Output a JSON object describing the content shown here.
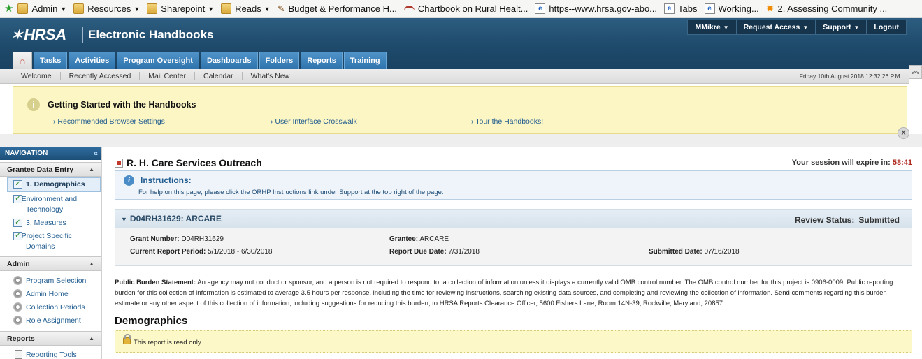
{
  "bookmarks": {
    "items": [
      {
        "label": "Admin",
        "icon": "folder-icon",
        "has_menu": true
      },
      {
        "label": "Resources",
        "icon": "folder-icon",
        "has_menu": true
      },
      {
        "label": "Sharepoint",
        "icon": "folder-icon",
        "has_menu": true
      },
      {
        "label": "Reads",
        "icon": "folder-icon",
        "has_menu": true
      },
      {
        "label": "Budget & Performance  H...",
        "icon": "pen-icon"
      },
      {
        "label": "Chartbook on Rural Healt...",
        "icon": "arc-icon"
      },
      {
        "label": "https--www.hrsa.gov-abo...",
        "icon": "ie-icon"
      },
      {
        "label": "Tabs",
        "icon": "ie-icon"
      },
      {
        "label": "Working...",
        "icon": "ie-icon"
      },
      {
        "label": "2. Assessing Community ...",
        "icon": "sun-icon"
      }
    ]
  },
  "header": {
    "logo": "HRSA",
    "app_title": "Electronic Handbooks",
    "top_links": [
      {
        "label": "MMikre",
        "menu": true
      },
      {
        "label": "Request Access",
        "menu": true
      },
      {
        "label": "Support",
        "menu": true
      },
      {
        "label": "Logout",
        "menu": false
      }
    ],
    "tabs": [
      "Tasks",
      "Activities",
      "Program Oversight",
      "Dashboards",
      "Folders",
      "Reports",
      "Training"
    ]
  },
  "subnav": {
    "items": [
      "Welcome",
      "Recently Accessed",
      "Mail Center",
      "Calendar",
      "What's New"
    ],
    "date": "Friday  10th  August  2018  12:32:26  P.M."
  },
  "getting_started": {
    "title": "Getting Started with the Handbooks",
    "links": [
      "Recommended Browser Settings",
      "User Interface Crosswalk",
      "Tour the Handbooks!"
    ]
  },
  "nav": {
    "header": "NAVIGATION",
    "sections": [
      {
        "title": "Grantee Data Entry",
        "items": [
          "1. Demographics",
          "2. Environment and Technology",
          "3. Measures",
          "4. Project Specific Domains"
        ]
      },
      {
        "title": "Admin",
        "items": [
          "Program Selection",
          "Admin Home",
          "Collection Periods",
          "Role Assignment"
        ]
      },
      {
        "title": "Reports",
        "items": [
          "Reporting Tools"
        ]
      }
    ]
  },
  "main": {
    "page_title": "R. H. Care Services Outreach",
    "session_label": "Your session will expire in:",
    "session_time": "58:41",
    "instructions": {
      "title": "Instructions:",
      "text": "For help on this page, please click the ORHP Instructions link under Support at the top right of the page."
    },
    "grant": {
      "title": "D04RH31629: ARCARE",
      "review_label": "Review Status:",
      "review_value": "Submitted",
      "fields": [
        {
          "label": "Grant Number:",
          "value": "D04RH31629"
        },
        {
          "label": "Grantee:",
          "value": "ARCARE"
        },
        {
          "label": "Current Report Period:",
          "value": "5/1/2018 - 6/30/2018"
        },
        {
          "label": "Report Due Date:",
          "value": "7/31/2018"
        },
        {
          "label": "Submitted Date:",
          "value": "07/16/2018"
        }
      ]
    },
    "burden_label": "Public Burden Statement:",
    "burden_text": "An agency may not conduct or sponsor, and a person is not required to respond to, a collection of information unless it displays a currently valid OMB control number.  The OMB control number for this project is 0906-0009. Public reporting burden for this collection of information is estimated to average 3.5 hours per response, including the time for reviewing instructions, searching existing data sources, and completing and reviewing the collection of information. Send comments regarding this burden estimate or any other aspect of this collection of information, including suggestions for reducing this burden, to HRSA Reports Clearance Officer, 5600 Fishers Lane, Room 14N-39, Rockville, Maryland, 20857.",
    "section_title": "Demographics",
    "readonly_text": "This report is read only."
  }
}
